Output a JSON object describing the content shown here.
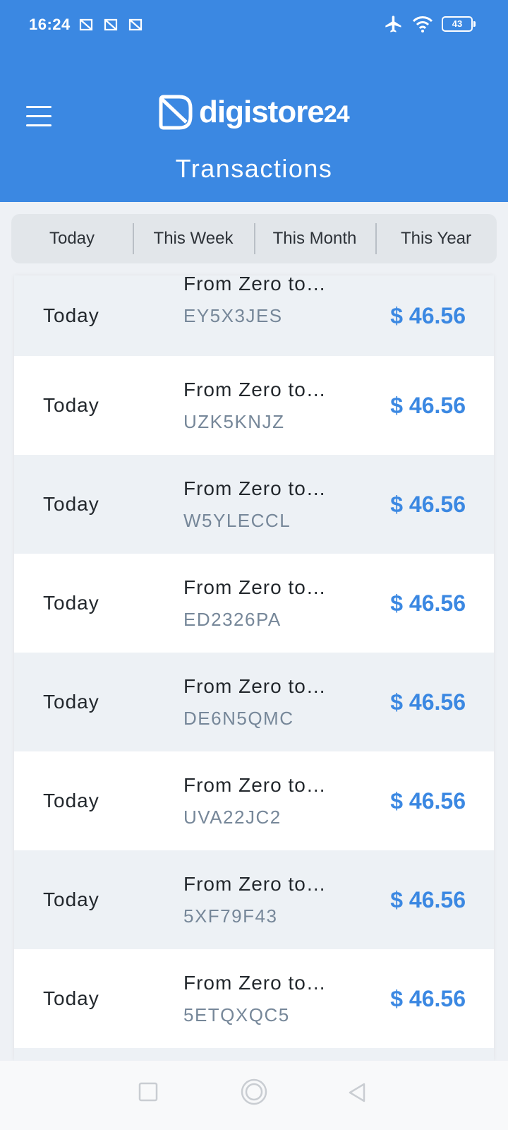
{
  "status_bar": {
    "time": "16:24",
    "battery": "43"
  },
  "brand": {
    "name": "digistore",
    "suffix": "24"
  },
  "page": {
    "title": "Transactions"
  },
  "tabs": [
    {
      "label": "Today"
    },
    {
      "label": "This Week"
    },
    {
      "label": "This Month"
    },
    {
      "label": "This Year"
    }
  ],
  "transactions": [
    {
      "date": "Today",
      "product": "From Zero to…",
      "code": "EY5X3JES",
      "amount": "$ 46.56"
    },
    {
      "date": "Today",
      "product": "From Zero to…",
      "code": "UZK5KNJZ",
      "amount": "$ 46.56"
    },
    {
      "date": "Today",
      "product": "From Zero to…",
      "code": "W5YLECCL",
      "amount": "$ 46.56"
    },
    {
      "date": "Today",
      "product": "From Zero to…",
      "code": "ED2326PA",
      "amount": "$ 46.56"
    },
    {
      "date": "Today",
      "product": "From Zero to…",
      "code": "DE6N5QMC",
      "amount": "$ 46.56"
    },
    {
      "date": "Today",
      "product": "From Zero to…",
      "code": "UVA22JC2",
      "amount": "$ 46.56"
    },
    {
      "date": "Today",
      "product": "From Zero to…",
      "code": "5XF79F43",
      "amount": "$ 46.56"
    },
    {
      "date": "Today",
      "product": "From Zero to…",
      "code": "5ETQXQC5",
      "amount": "$ 46.56"
    }
  ],
  "colors": {
    "header": "#3b88e2",
    "amount": "#3b88e2",
    "code": "#768799"
  }
}
